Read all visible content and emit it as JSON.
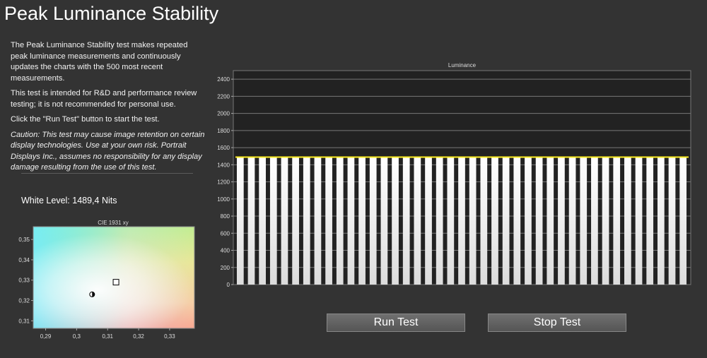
{
  "page": {
    "title": "Peak Luminance Stability"
  },
  "description": {
    "p1": "The Peak Luminance Stability test makes repeated peak luminance measurements and continuously updates the charts with the 500 most recent measurements.",
    "p2": "This test is intended for R&D and performance review testing; it is not recommended for personal use.",
    "p3": "Click the \"Run Test\" button to start the test.",
    "caution": "Caution: This test may cause image retention on certain display technologies. Use at your own risk. Portrait Displays Inc., assumes no responsibility for any display damage resulting from the use of this test."
  },
  "white_level": {
    "text": "White Level: 1489,4 Nits"
  },
  "buttons": {
    "run": "Run Test",
    "stop": "Stop Test"
  },
  "colors": {
    "background": "#333333",
    "plot_background": "#222222",
    "line": "#ffee22",
    "bar_top": "#ffffff",
    "bar_bottom": "#dcdcdc"
  },
  "chart_data": [
    {
      "type": "bar",
      "title": "Luminance",
      "xlabel": "",
      "ylabel": "",
      "ylim": [
        0,
        2500
      ],
      "yticks": [
        "0",
        "200",
        "400",
        "600",
        "800",
        "1000",
        "1200",
        "1400",
        "1600",
        "1800",
        "2000",
        "2200",
        "2400"
      ],
      "bar_count": 41,
      "values": [
        1489,
        1489,
        1489,
        1489,
        1489,
        1489,
        1489,
        1489,
        1489,
        1489,
        1489,
        1489,
        1489,
        1489,
        1489,
        1489,
        1489,
        1489,
        1489,
        1489,
        1489,
        1489,
        1489,
        1489,
        1489,
        1489,
        1489,
        1489,
        1489,
        1489,
        1489,
        1489,
        1489,
        1489,
        1489,
        1489,
        1489,
        1489,
        1489,
        1489,
        1489
      ],
      "line_value": 1489.4,
      "grid": true,
      "legend": "none"
    },
    {
      "type": "scatter",
      "title": "CIE 1931 xy",
      "xlim": [
        0.286,
        0.338
      ],
      "ylim": [
        0.3063,
        0.3563
      ],
      "xticks": [
        "0,29",
        "0,3",
        "0,31",
        "0,32",
        "0,33"
      ],
      "xtick_values": [
        0.29,
        0.3,
        0.31,
        0.32,
        0.33
      ],
      "yticks": [
        "0,35",
        "0,34",
        "0,33",
        "0,32",
        "0,31"
      ],
      "ytick_values": [
        0.35,
        0.34,
        0.33,
        0.32,
        0.31
      ],
      "points": [
        {
          "name": "target",
          "x": 0.3127,
          "y": 0.329,
          "marker": "square"
        },
        {
          "name": "measured",
          "x": 0.305,
          "y": 0.323,
          "marker": "circle"
        }
      ]
    }
  ]
}
